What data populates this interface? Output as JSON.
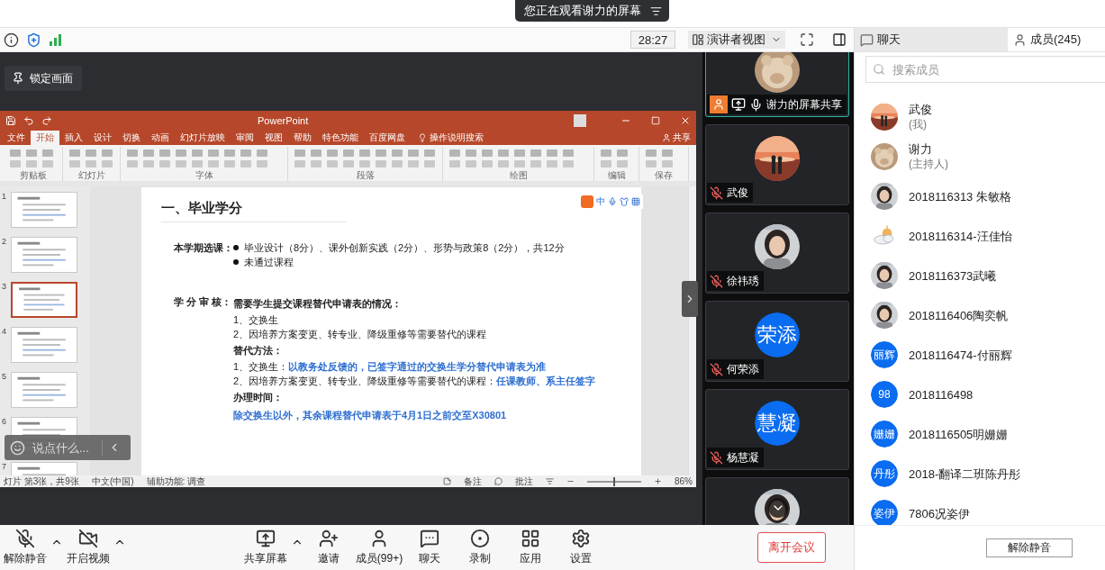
{
  "banner": {
    "text": "您正在观看谢力的屏幕"
  },
  "toolbar": {
    "timer": "28:27",
    "view_menu": "演讲者视图"
  },
  "lock_button": {
    "label": "锁定画面"
  },
  "shared_window": {
    "title": "PowerPoint",
    "tabs": [
      {
        "label": "文件",
        "selected": false
      },
      {
        "label": "开始",
        "selected": true
      },
      {
        "label": "插入",
        "selected": false
      },
      {
        "label": "设计",
        "selected": false
      },
      {
        "label": "切换",
        "selected": false
      },
      {
        "label": "动画",
        "selected": false
      },
      {
        "label": "幻灯片放映",
        "selected": false
      },
      {
        "label": "审阅",
        "selected": false
      },
      {
        "label": "视图",
        "selected": false
      },
      {
        "label": "帮助",
        "selected": false
      },
      {
        "label": "特色功能",
        "selected": false
      },
      {
        "label": "百度网盘",
        "selected": false
      }
    ],
    "tell_me": "操作说明搜索",
    "share": "共享",
    "ribbon_groups": [
      "剪贴板",
      "幻灯片",
      "字体",
      "段落",
      "绘图",
      "编辑",
      "保存"
    ],
    "thumbnails": [
      {
        "number": "1",
        "selected": false
      },
      {
        "number": "2",
        "selected": false
      },
      {
        "number": "3",
        "selected": true
      },
      {
        "number": "4",
        "selected": false
      },
      {
        "number": "5",
        "selected": false
      },
      {
        "number": "6",
        "selected": false
      },
      {
        "number": "7",
        "selected": false
      }
    ],
    "slide": {
      "title": "一、毕业学分",
      "sections": [
        {
          "label": "本学期选课：",
          "lines": [
            {
              "kind": "bullet",
              "text": "毕业设计（8分）、课外创新实践（2分）、形势与政策8（2分），共12分"
            },
            {
              "kind": "bullet",
              "text": "未通过课程"
            }
          ]
        },
        {
          "label": "学 分 审 核：",
          "lines": [
            {
              "kind": "heading",
              "text": "需要学生提交课程替代申请表的情况："
            },
            {
              "kind": "plain",
              "text": "1、交换生"
            },
            {
              "kind": "plain",
              "text": "2、因培养方案变更、转专业、降级重修等需要替代的课程"
            },
            {
              "kind": "heading",
              "text": "替代方法："
            },
            {
              "kind": "plain",
              "text": "1、交换生：**以教务处反馈的，已签字通过的交换生学分替代申请表为准**"
            },
            {
              "kind": "plain",
              "text": "2、因培养方案变更、转专业、降级重修等需要替代的课程：**任课教师、系主任签字**"
            },
            {
              "kind": "heading",
              "text": "办理时间："
            },
            {
              "kind": "highlight",
              "text": "除交换生以外，其余课程替代申请表于4月1日之前交至X30801"
            }
          ]
        }
      ]
    },
    "ime": {
      "mode": "中"
    },
    "status": {
      "left": [
        "灯片 第3张，共9张",
        "中文(中国)",
        "辅助功能: 调查"
      ],
      "right": [
        "备注",
        "批注"
      ],
      "zoom": {
        "reading": "86%",
        "level": 0.5
      }
    }
  },
  "chat_input": {
    "placeholder": "说点什么..."
  },
  "video_tiles": [
    {
      "name": "谢力的屏幕共享",
      "muted": false,
      "sharing": true,
      "active": true
    },
    {
      "name": "武俊",
      "muted": true,
      "sharing": false,
      "active": false
    },
    {
      "name": "徐祎琇",
      "muted": true,
      "sharing": false,
      "active": false
    },
    {
      "name": "何荣添",
      "avatar": {
        "kind": "text",
        "text": "荣添"
      },
      "muted": true,
      "sharing": false,
      "active": false
    },
    {
      "name": "杨慧凝",
      "avatar": {
        "kind": "text",
        "text": "慧凝"
      },
      "muted": true,
      "sharing": false,
      "active": false
    },
    {
      "active": false
    }
  ],
  "panel_tabs": [
    {
      "label": "聊天",
      "kind": "chat",
      "selected": false
    },
    {
      "label": "成员(245)",
      "kind": "members",
      "selected": true
    }
  ],
  "member_search": {
    "placeholder": "搜索成员"
  },
  "members": [
    {
      "name": "武俊",
      "role": "(我)"
    },
    {
      "name": "谢力",
      "role": "(主持人)"
    },
    {
      "name": "2018116313 朱敏格"
    },
    {
      "name": "2018116314-汪佳怡"
    },
    {
      "name": "2018116373武曦"
    },
    {
      "name": "2018116406陶奕帆"
    },
    {
      "name": "2018116474-付丽辉",
      "avatar": {
        "kind": "text",
        "text": "丽辉"
      }
    },
    {
      "name": "2018116498",
      "avatar": {
        "kind": "text",
        "text": "98"
      }
    },
    {
      "name": "2018116505明姗姗",
      "avatar": {
        "kind": "text",
        "text": "姗姗"
      }
    },
    {
      "name": "2018-翻译二班陈丹彤",
      "avatar": {
        "kind": "text",
        "text": "丹彤"
      }
    },
    {
      "name": "7806况姿伊",
      "avatar": {
        "kind": "text",
        "text": "姿伊"
      }
    }
  ],
  "unmute_all": {
    "label": "解除静音"
  },
  "controls": {
    "audio_video": [
      {
        "kind": "mic-off",
        "label": "解除静音",
        "menu": true
      },
      {
        "kind": "video-off",
        "label": "开启视频",
        "menu": true
      }
    ],
    "meeting": [
      {
        "kind": "share",
        "label": "共享屏幕",
        "menu": true
      },
      {
        "kind": "invite",
        "label": "邀请",
        "menu": false
      },
      {
        "kind": "members",
        "label": "成员(99+)",
        "menu": false
      },
      {
        "kind": "chat",
        "label": "聊天",
        "menu": false
      },
      {
        "kind": "record",
        "label": "录制",
        "menu": false
      },
      {
        "kind": "apps",
        "label": "应用",
        "menu": false
      },
      {
        "kind": "settings",
        "label": "设置",
        "menu": false
      }
    ]
  },
  "leave_button": {
    "label": "离开会议"
  }
}
